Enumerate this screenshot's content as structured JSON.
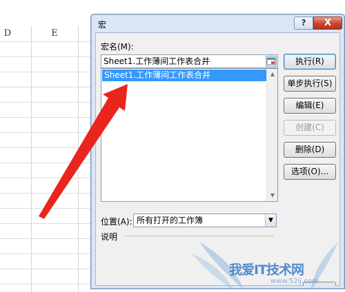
{
  "sheet": {
    "columns": [
      "D",
      "E"
    ]
  },
  "dialog": {
    "title": "宏",
    "help_label": "?",
    "close_label": "X",
    "macro_name_label": "宏名(M):",
    "macro_name_value": "Sheet1.工作薄间工作表合并",
    "macro_list": [
      "Sheet1.工作薄间工作表合并"
    ],
    "buttons": {
      "run": "执行(R)",
      "step_into": "单步执行(S)",
      "edit": "编辑(E)",
      "create": "创建(C)",
      "delete": "删除(D)",
      "options": "选项(O)..."
    },
    "location_label": "位置(A):",
    "location_value": "所有打开的工作簿",
    "description_label": "说明"
  },
  "watermark": {
    "text": "我爱IT技术网",
    "subtext": "www.52ij.com"
  },
  "colors": {
    "selection": "#3399ff",
    "arrow": "#e8261d",
    "dialog_frame": "#dbe6f4"
  }
}
